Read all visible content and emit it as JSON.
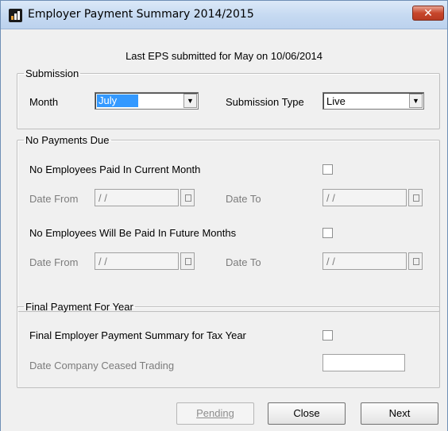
{
  "window": {
    "title": "Employer Payment Summary 2014/2015",
    "close_glyph": "✕"
  },
  "last_eps_text": "Last EPS submitted for May on 10/06/2014",
  "submission": {
    "legend": "Submission",
    "month_label": "Month",
    "month_value": "July",
    "type_label": "Submission Type",
    "type_value": "Live"
  },
  "no_payments": {
    "legend": "No Payments Due",
    "current_label": "No Employees Paid In Current Month",
    "current_checked": false,
    "future_label": "No Employees Will Be Paid In Future Months",
    "future_checked": false,
    "date_from_label": "Date From",
    "date_to_label": "Date To",
    "date_placeholder": " / /"
  },
  "final_payment": {
    "legend": "Final Payment For Year",
    "final_label": "Final Employer Payment Summary for Tax Year",
    "final_checked": false,
    "ceased_label": "Date Company Ceased Trading",
    "ceased_value": ""
  },
  "buttons": {
    "pending": "Pending",
    "close": "Close",
    "next": "Next"
  }
}
